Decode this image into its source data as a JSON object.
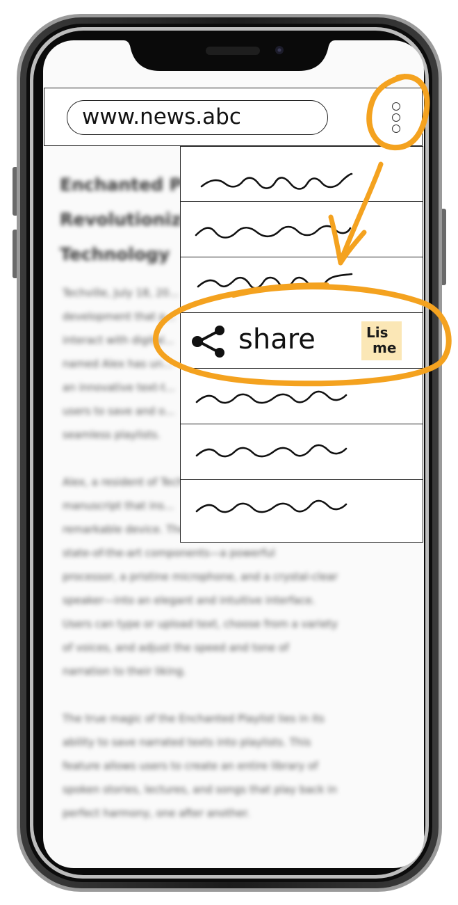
{
  "browser": {
    "url": "www.news.abc",
    "menu_icon": "kebab-vertical-icon"
  },
  "article": {
    "headline_lines": [
      "Enchanted Playlist:",
      "Revolutionizing",
      "Technology"
    ],
    "paragraph1_lines": [
      "Techville, July 18, 20...",
      "development that p...",
      "interact with digital...",
      "named Alex has un...",
      "an innovative text-t...",
      "users to save and o...",
      "seamless playlists."
    ],
    "paragraph2_lines": [
      "Alex, a resident of Techville...",
      "manuscript that ins...",
      "remarkable device. The Enchanted Playlist combines",
      "state-of-the-art components—a powerful",
      "processor, a pristine microphone, and a crystal-clear",
      "speaker—into an elegant and intuitive interface.",
      "Users can type or upload text, choose from a variety",
      "of voices, and adjust the speed and tone of",
      "narration to their liking."
    ],
    "paragraph3_lines": [
      "The true magic of the Enchanted Playlist lies in its",
      "ability to save narrated texts into playlists. This",
      "feature allows users to create an entire library of",
      "spoken stories, lectures, and songs that play back in",
      "perfect harmony, one after another."
    ]
  },
  "menu": {
    "share_label": "share",
    "share_icon": "share-icon",
    "logo_line1": "Lis",
    "logo_line2": "me"
  },
  "annotations": {
    "highlight_color": "#f4a21f"
  }
}
